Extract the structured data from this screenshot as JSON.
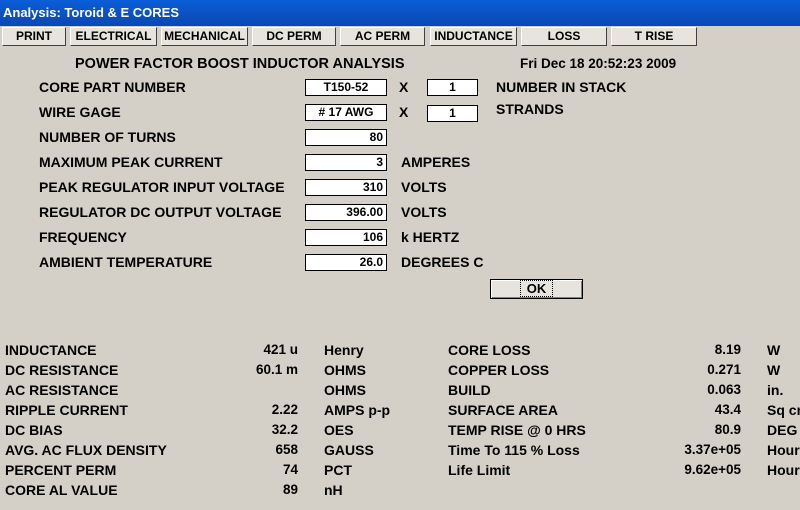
{
  "window": {
    "title": "Analysis: Toroid & E CORES"
  },
  "tabs": [
    "PRINT",
    "ELECTRICAL",
    "MECHANICAL",
    "DC PERM",
    "AC PERM",
    "INDUCTANCE",
    "LOSS",
    "T RISE"
  ],
  "header": {
    "title": "POWER FACTOR BOOST INDUCTOR ANALYSIS",
    "datetime": "Fri Dec 18 20:52:23 2009"
  },
  "inputs": {
    "core_part": {
      "label": "CORE PART NUMBER",
      "value": "T150-52",
      "x": "X",
      "stack_value": "1",
      "stack_label": "NUMBER IN STACK"
    },
    "wire_gage": {
      "label": "WIRE GAGE",
      "value": "# 17 AWG",
      "x": "X",
      "strands_value": "1",
      "strands_label": "STRANDS"
    },
    "turns": {
      "label": "NUMBER OF TURNS",
      "value": "80",
      "unit": ""
    },
    "peak_current": {
      "label": "MAXIMUM PEAK CURRENT",
      "value": "3",
      "unit": "AMPERES"
    },
    "input_voltage": {
      "label": "PEAK REGULATOR INPUT VOLTAGE",
      "value": "310",
      "unit": "VOLTS"
    },
    "output_voltage": {
      "label": "REGULATOR DC OUTPUT VOLTAGE",
      "value": "396.00",
      "unit": "VOLTS"
    },
    "frequency": {
      "label": "FREQUENCY",
      "value": "106",
      "unit": "k HERTZ"
    },
    "ambient": {
      "label": "AMBIENT TEMPERATURE",
      "value": "26.0",
      "unit": "DEGREES C"
    }
  },
  "ok_button": {
    "label": "OK"
  },
  "results_left": [
    {
      "label": "INDUCTANCE",
      "value": "421 u",
      "unit": "Henry"
    },
    {
      "label": "DC RESISTANCE",
      "value": "60.1 m",
      "unit": "OHMS"
    },
    {
      "label": "AC RESISTANCE",
      "value": "",
      "unit": "OHMS"
    },
    {
      "label": "RIPPLE CURRENT",
      "value": "2.22",
      "unit": "AMPS p-p"
    },
    {
      "label": "DC BIAS",
      "value": "32.2",
      "unit": "OES"
    },
    {
      "label": "AVG. AC FLUX DENSITY",
      "value": "658",
      "unit": "GAUSS"
    },
    {
      "label": "PERCENT PERM",
      "value": "74",
      "unit": "PCT"
    },
    {
      "label": "CORE AL VALUE",
      "value": "89",
      "unit": "nH"
    }
  ],
  "results_right": [
    {
      "label": "CORE LOSS",
      "value": "8.19",
      "unit": "W"
    },
    {
      "label": "COPPER LOSS",
      "value": "0.271",
      "unit": "W"
    },
    {
      "label": "BUILD",
      "value": "0.063",
      "unit": "in."
    },
    {
      "label": "SURFACE AREA",
      "value": "43.4",
      "unit": "Sq cm"
    },
    {
      "label": "TEMP RISE @ 0 HRS",
      "value": "80.9",
      "unit": "DEG C"
    },
    {
      "label": "Time To 115 % Loss",
      "value": "3.37e+05",
      "unit": "Hours"
    },
    {
      "label": "Life Limit",
      "value": "9.62e+05",
      "unit": "Hours"
    }
  ]
}
